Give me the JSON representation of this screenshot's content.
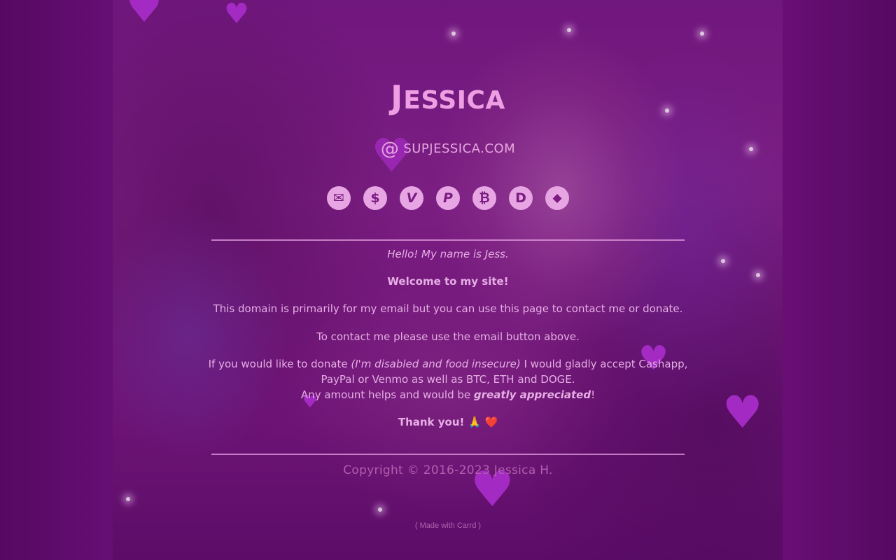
{
  "profile": {
    "name_initial": "J",
    "name_rest": "ESSICA",
    "domain_at": "@",
    "domain": "SUPJESSICA.COM"
  },
  "icons": [
    {
      "name": "email",
      "glyph": "✉"
    },
    {
      "name": "cashapp",
      "glyph": "$"
    },
    {
      "name": "venmo",
      "glyph": "V"
    },
    {
      "name": "paypal",
      "glyph": "P"
    },
    {
      "name": "bitcoin",
      "glyph": "₿"
    },
    {
      "name": "dogecoin",
      "glyph": "D"
    },
    {
      "name": "ethereum",
      "glyph": "◆"
    }
  ],
  "body": {
    "hello": "Hello! My name is Jess.",
    "welcome": "Welcome to my site!",
    "purpose": "This domain is primarily for my email but you can use this page to contact me or donate.",
    "contact": "To contact me please use the email button above.",
    "donate_start": "If you would like to donate ",
    "donate_note": "(I'm disabled and food insecure)",
    "donate_end": " I would gladly accept Cashapp, PayPal or Venmo as well as BTC, ETH and DOGE.",
    "amount_start": "Any amount helps and would be ",
    "amount_emph": "greatly appreciated",
    "amount_end": "!",
    "thanks": "Thank you! 🙏 ❤️"
  },
  "footer": {
    "copyright": "Copyright © 2016-2023 Jessica H.",
    "made_with": "( Made with Carrd )"
  },
  "colors": {
    "background": "#4d0a56",
    "accent": "#ee9ee2",
    "icon_bg": "#e7a6e3",
    "heart": "#a32ac2"
  }
}
